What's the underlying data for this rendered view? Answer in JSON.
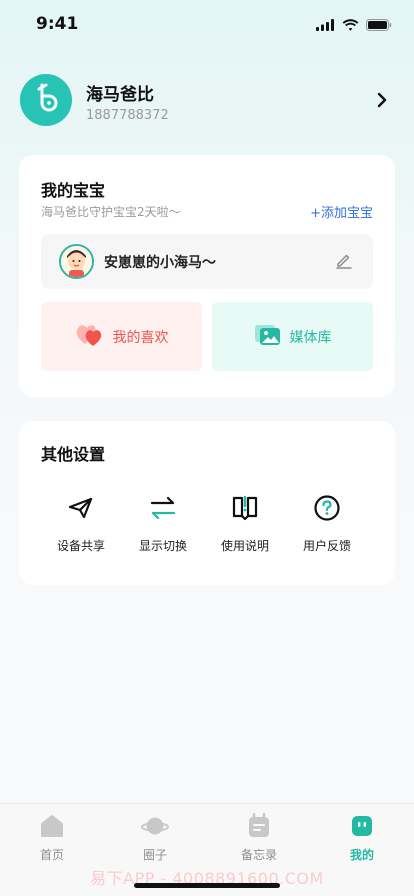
{
  "status_bar": {
    "time": "9:41"
  },
  "profile": {
    "name": "海马爸比",
    "phone": "1887788372"
  },
  "baby_section": {
    "title": "我的宝宝",
    "subtitle": "海马爸比守护宝宝2天啦～",
    "add_label": "+添加宝宝",
    "baby_name": "安崽崽的小海马～",
    "favorites_label": "我的喜欢",
    "media_label": "媒体库"
  },
  "settings_section": {
    "title": "其他设置",
    "items": [
      {
        "label": "设备共享",
        "icon": "paper-plane-icon"
      },
      {
        "label": "显示切换",
        "icon": "swap-arrows-icon"
      },
      {
        "label": "使用说明",
        "icon": "book-info-icon"
      },
      {
        "label": "用户反馈",
        "icon": "question-circle-icon"
      }
    ]
  },
  "tabbar": {
    "tabs": [
      {
        "label": "首页",
        "icon": "home-icon"
      },
      {
        "label": "圈子",
        "icon": "planet-icon"
      },
      {
        "label": "备忘录",
        "icon": "memo-icon"
      },
      {
        "label": "我的",
        "icon": "profile-face-icon",
        "active": true
      }
    ]
  },
  "watermark": "易下APP - 4008891600.COM",
  "colors": {
    "accent": "#23b9a5",
    "link": "#2f6fe0",
    "favorite": "#f0544c"
  }
}
